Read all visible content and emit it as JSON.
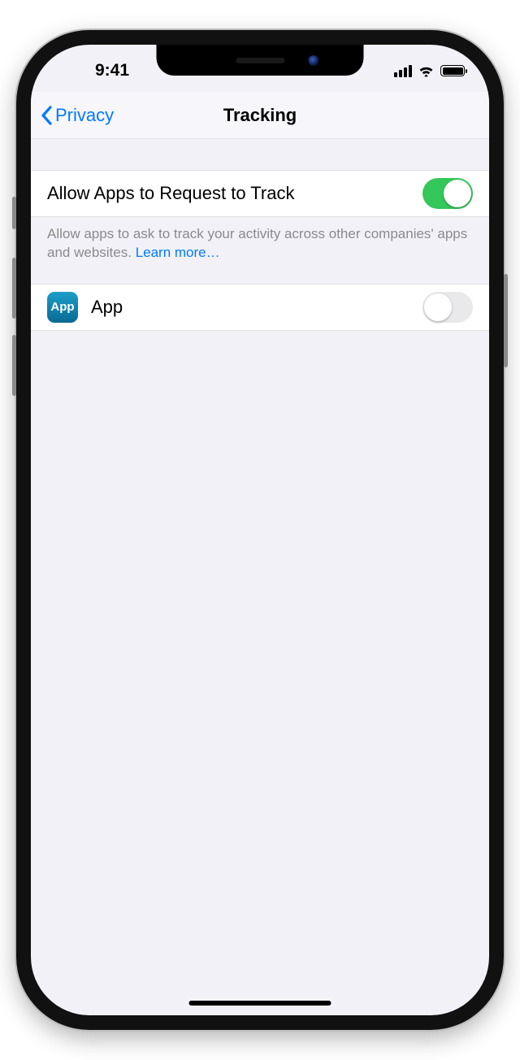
{
  "status": {
    "time": "9:41"
  },
  "nav": {
    "back_label": "Privacy",
    "title": "Tracking"
  },
  "allow_row": {
    "label": "Allow Apps to Request to Track",
    "enabled": true
  },
  "footer": {
    "text": "Allow apps to ask to track your activity across other companies' apps and websites. ",
    "link": "Learn more…"
  },
  "app_row": {
    "icon_text": "App",
    "label": "App",
    "enabled": false
  }
}
